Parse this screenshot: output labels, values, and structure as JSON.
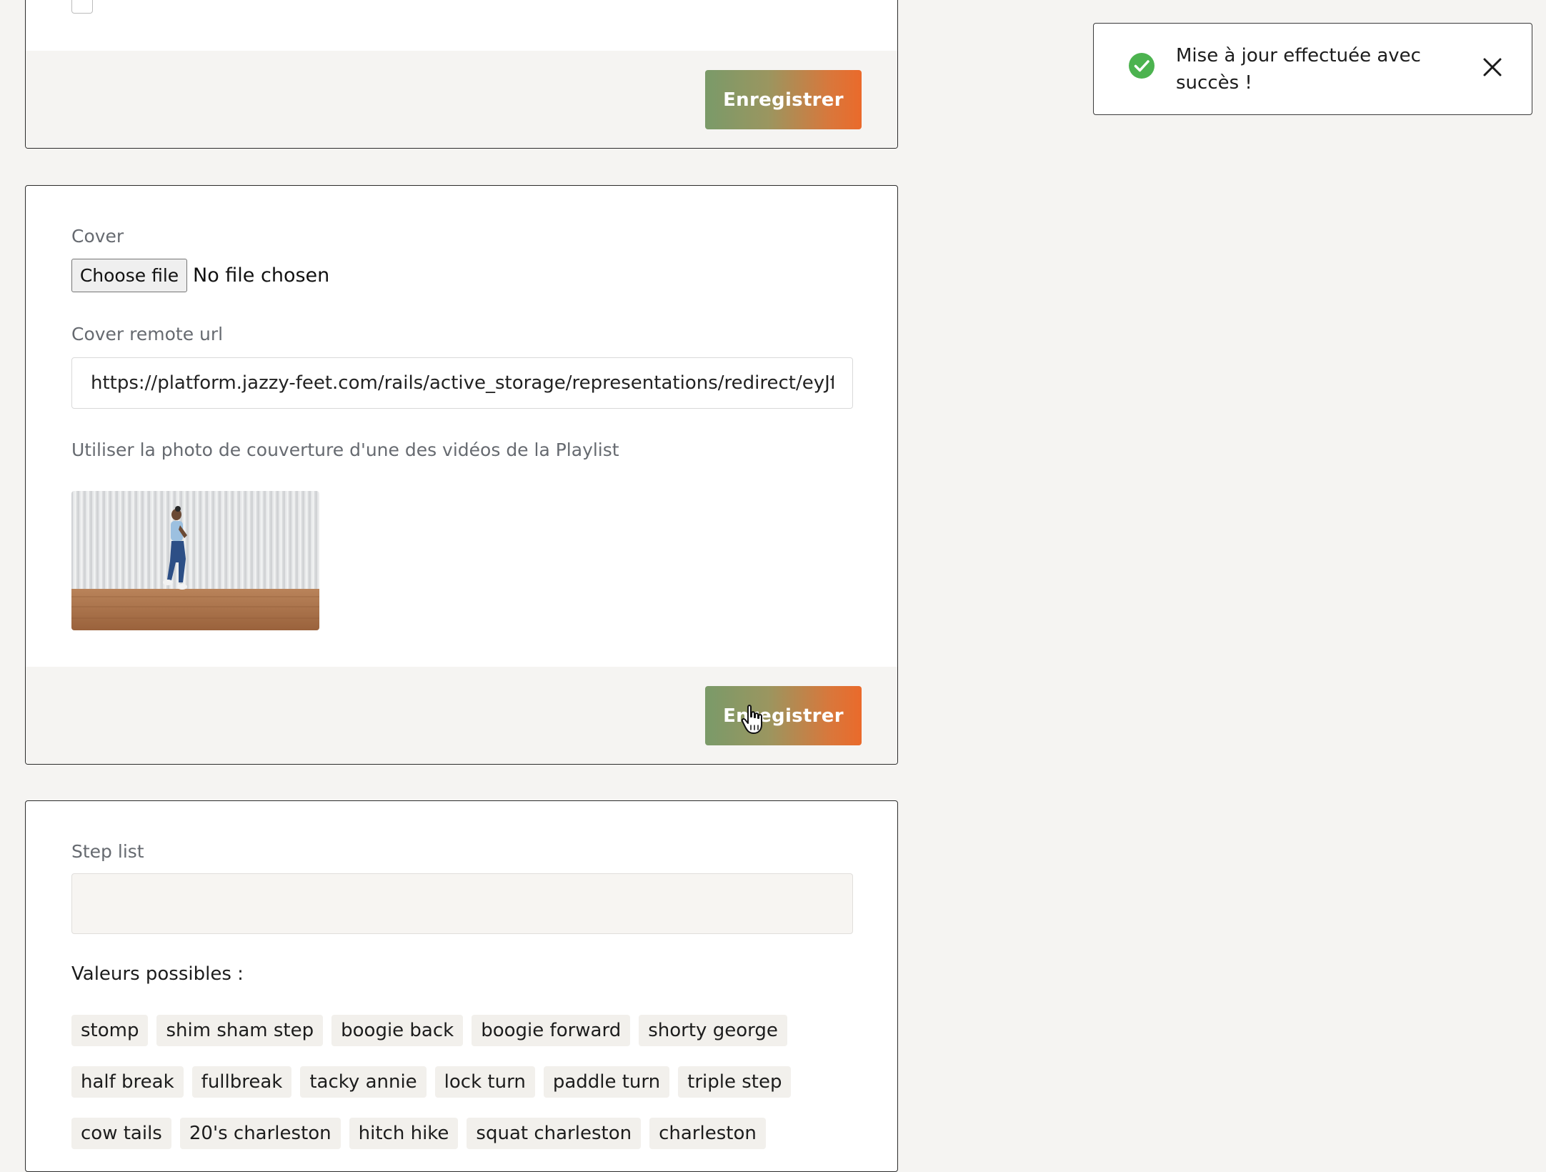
{
  "toast": {
    "message": "Mise à jour effectuée avec succès !",
    "icon": "check-circle-icon",
    "close_icon": "close-icon",
    "success_color": "#4cb34f"
  },
  "settings_card": {
    "partial_text": "Ⓟ          ⓖ",
    "save_label": "Enregistrer"
  },
  "cover_card": {
    "cover_label": "Cover",
    "file_button": "Choose file",
    "file_status": "No file chosen",
    "remote_url_label": "Cover remote url",
    "remote_url_value": "https://platform.jazzy-feet.com/rails/active_storage/representations/redirect/eyJfcmFpbHMiOnsibWVzc2FnZSI6IkJBaHBBZz09IiwiZXhwIjpudWxsLCJwdXIiOiJibG9iX2lkIn19",
    "playlist_cover_label": "Utiliser la photo de couverture d'une des vidéos de la Playlist",
    "save_label": "Enregistrer"
  },
  "steps_card": {
    "step_list_label": "Step list",
    "step_list_value": "",
    "possible_values_title": "Valeurs possibles :",
    "possible_values": [
      "stomp",
      "shim sham step",
      "boogie back",
      "boogie forward",
      "shorty george",
      "half break",
      "fullbreak",
      "tacky annie",
      "lock turn",
      "paddle turn",
      "triple step",
      "cow tails",
      "20's charleston",
      "hitch hike",
      "squat charleston",
      "charleston"
    ]
  },
  "colors": {
    "button_gradient_start": "#7a9a69",
    "button_gradient_end": "#ea6a2b",
    "page_background": "#f5f4f2"
  }
}
